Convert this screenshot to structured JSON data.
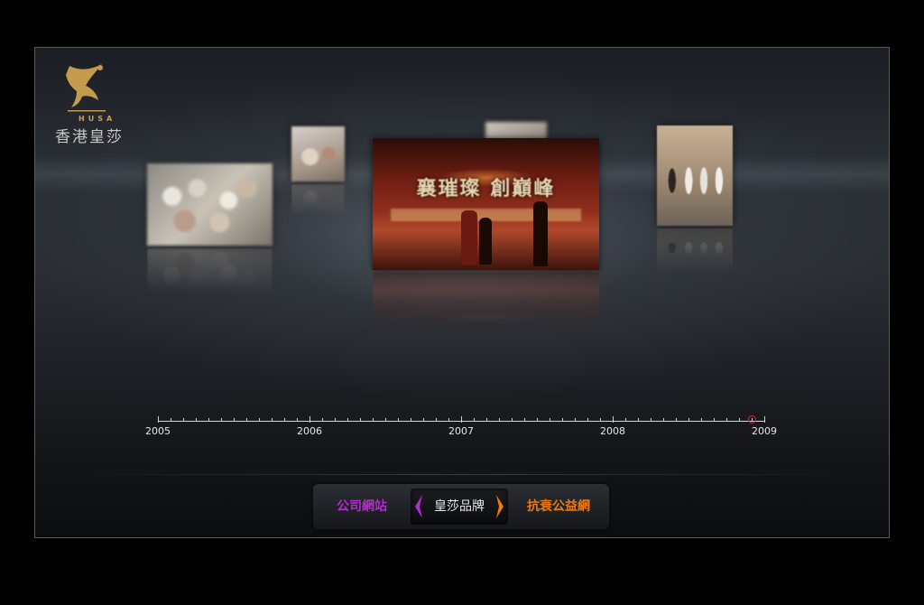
{
  "logo": {
    "brand_en": "HUSA",
    "brand_cn": "香港皇莎",
    "icon": "leaping-figure-icon"
  },
  "photos": [
    {
      "id": "crowd",
      "icon": "photo-crowd"
    },
    {
      "id": "small",
      "icon": "photo-meeting"
    },
    {
      "id": "back",
      "icon": "photo-background"
    },
    {
      "id": "stage",
      "icon": "photo-stage-event",
      "banner": "襄璀璨  創巔峰"
    },
    {
      "id": "group",
      "icon": "photo-group"
    }
  ],
  "timeline": {
    "years": [
      "2005",
      "2006",
      "2007",
      "2008",
      "2009"
    ],
    "selected_position": 0.98
  },
  "nav": {
    "left_label": "公司網站",
    "center_label": "皇莎品牌",
    "right_label": "抗衰公益網",
    "colors": {
      "left": "#b42bcf",
      "right": "#ef7a12",
      "arrow_left": "#b42bcf",
      "arrow_right": "#ef7a12"
    }
  }
}
